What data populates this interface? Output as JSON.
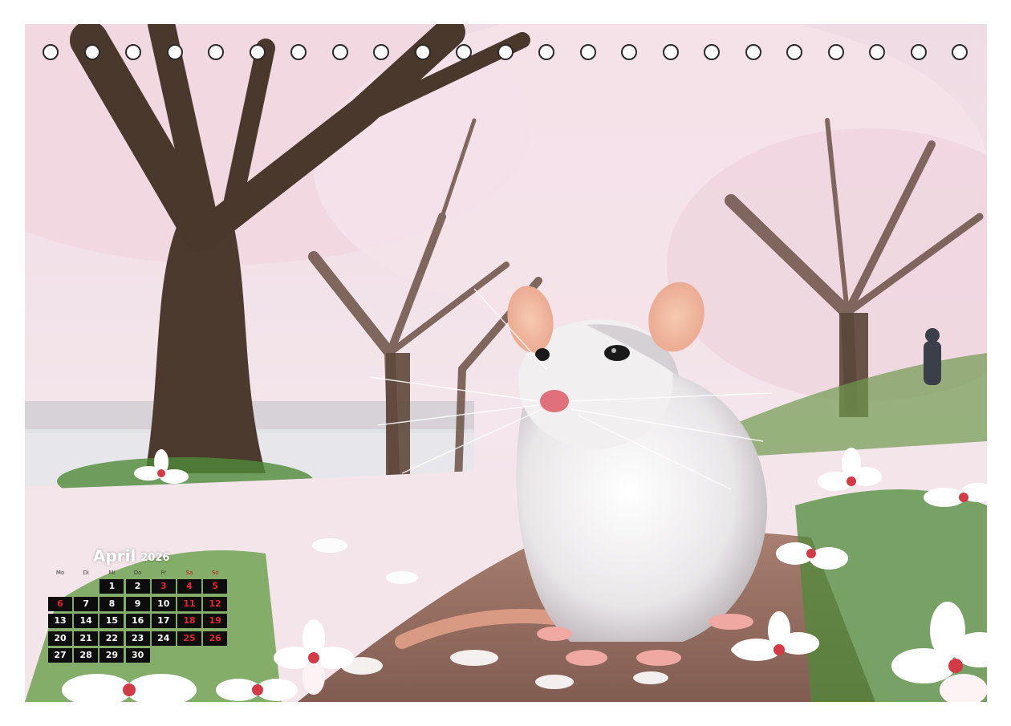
{
  "calendar": {
    "month": "April",
    "year": "2026",
    "weekdays": [
      {
        "label": "Mo",
        "weekend": false
      },
      {
        "label": "Di",
        "weekend": false
      },
      {
        "label": "Mi",
        "weekend": false
      },
      {
        "label": "Do",
        "weekend": false
      },
      {
        "label": "Fr",
        "weekend": false
      },
      {
        "label": "Sa",
        "weekend": true
      },
      {
        "label": "So",
        "weekend": true
      }
    ],
    "weeks": [
      [
        null,
        null,
        "1",
        "2",
        "3",
        "4",
        "5"
      ],
      [
        "6",
        "7",
        "8",
        "9",
        "10",
        "11",
        "12"
      ],
      [
        "13",
        "14",
        "15",
        "16",
        "17",
        "18",
        "19"
      ],
      [
        "20",
        "21",
        "22",
        "23",
        "24",
        "25",
        "26"
      ],
      [
        "27",
        "28",
        "29",
        "30",
        null,
        null,
        null
      ]
    ],
    "holidays": [
      "3",
      "6"
    ],
    "weekend_color": "#e0262e"
  },
  "photo": {
    "subject": "white-rat",
    "palette": {
      "blossom": "#f3dde4",
      "trunk": "#4a3a2c",
      "ground": "#8a5a44",
      "grass": "#4f8a3a"
    }
  }
}
